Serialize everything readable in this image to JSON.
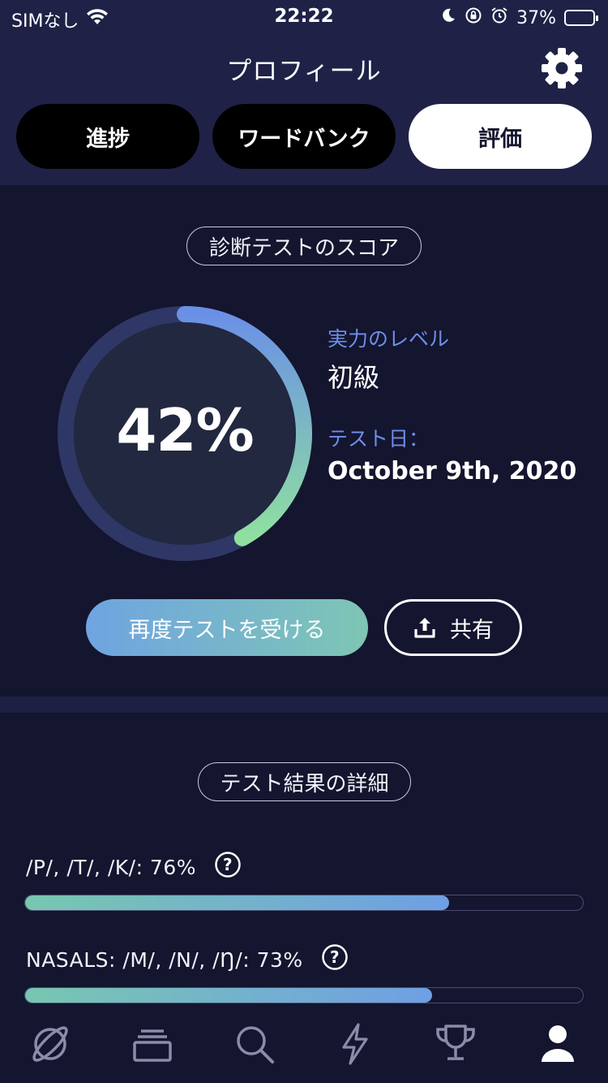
{
  "status_bar": {
    "carrier": "SIMなし",
    "time": "22:22",
    "battery_pct": "37%"
  },
  "header": {
    "title": "プロフィール",
    "settings_icon": "gear-icon"
  },
  "tabs": [
    {
      "label": "進捗",
      "active": false
    },
    {
      "label": "ワードバンク",
      "active": false
    },
    {
      "label": "評価",
      "active": true
    }
  ],
  "score_section": {
    "title": "診断テストのスコア",
    "percent_label": "42%",
    "percent_value": 0.42,
    "level_label": "実力のレベル",
    "level_value": "初級",
    "date_label": "テスト日：",
    "date_value": "October 9th, 2020",
    "retest_label": "再度テストを受ける",
    "share_label": "共有"
  },
  "details_section": {
    "title": "テスト結果の詳細",
    "rows": [
      {
        "label": "/P/, /T/, /K/:  76%",
        "value": 0.76
      },
      {
        "label": "NASALS: /M/, /N/, /Ŋ/:  73%",
        "value": 0.73
      }
    ]
  },
  "bottom_nav": [
    {
      "icon": "planet-icon",
      "active": false
    },
    {
      "icon": "cards-stack-icon",
      "active": false
    },
    {
      "icon": "search-icon",
      "active": false
    },
    {
      "icon": "lightning-icon",
      "active": false
    },
    {
      "icon": "trophy-icon",
      "active": false
    },
    {
      "icon": "profile-icon",
      "active": true
    }
  ],
  "colors": {
    "background": "#14152e",
    "header": "#1f2147",
    "accent_blue": "#6f9fe4",
    "accent_green": "#85dba6",
    "label_blue": "#6e8ee8"
  }
}
